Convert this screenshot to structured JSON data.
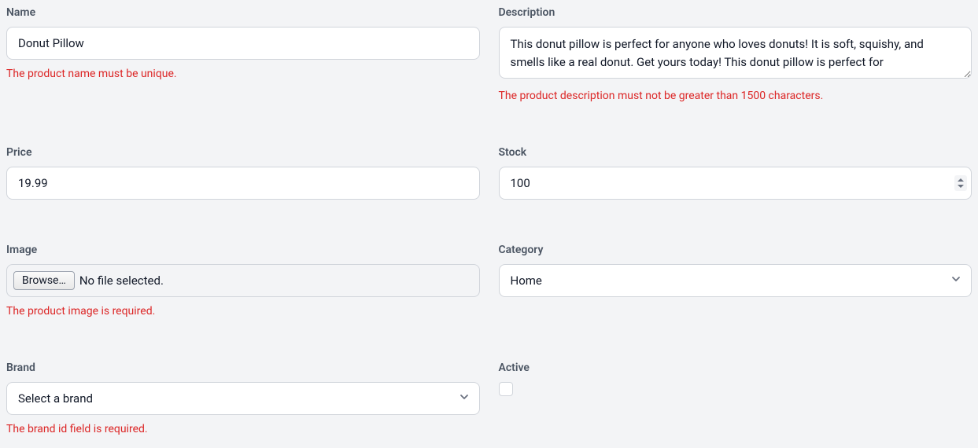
{
  "fields": {
    "name": {
      "label": "Name",
      "value": "Donut Pillow",
      "error": "The product name must be unique."
    },
    "description": {
      "label": "Description",
      "value": "This donut pillow is perfect for anyone who loves donuts! It is soft, squishy, and smells like a real donut. Get yours today! This donut pillow is perfect for",
      "error": "The product description must not be greater than 1500 characters."
    },
    "price": {
      "label": "Price",
      "value": "19.99"
    },
    "stock": {
      "label": "Stock",
      "value": "100"
    },
    "image": {
      "label": "Image",
      "browse_label": "Browse…",
      "no_file_text": "No file selected.",
      "error": "The product image is required."
    },
    "category": {
      "label": "Category",
      "value": "Home"
    },
    "brand": {
      "label": "Brand",
      "placeholder": "Select a brand",
      "error": "The brand id field is required."
    },
    "active": {
      "label": "Active",
      "checked": false
    }
  }
}
